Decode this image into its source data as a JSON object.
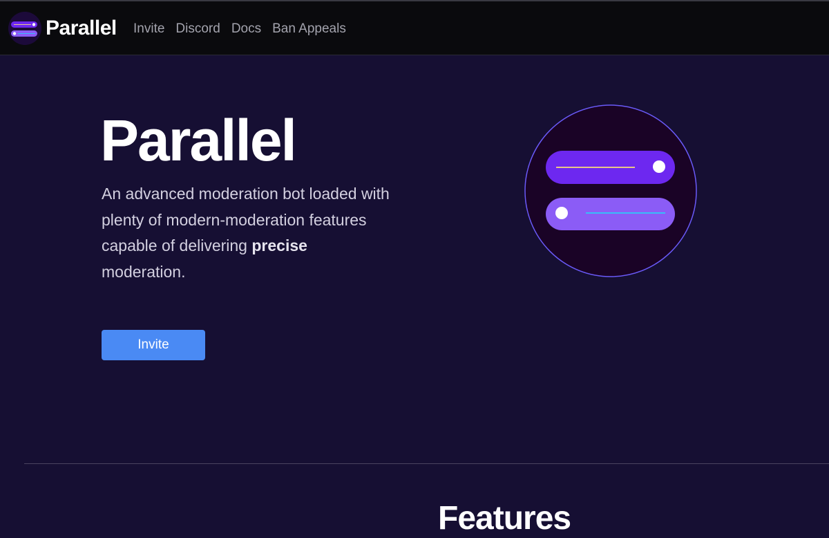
{
  "brand": {
    "name": "Parallel",
    "logo_icon": "parallel-toggles-logo"
  },
  "nav": {
    "items": [
      {
        "label": "Invite"
      },
      {
        "label": "Discord"
      },
      {
        "label": "Docs"
      },
      {
        "label": "Ban Appeals"
      }
    ]
  },
  "hero": {
    "title": "Parallel",
    "description_before": "An advanced moderation bot loaded with plenty of modern-moderation features capable of delivering ",
    "description_bold": "precise",
    "description_after": " moderation.",
    "invite_label": "Invite",
    "illustration_icon": "parallel-toggles-illustration"
  },
  "features": {
    "heading": "Features"
  },
  "colors": {
    "page_background": "#160f33",
    "topbar_background": "#0a0a0d",
    "accent_button": "#4a8af4",
    "toggle_dark": "#6d28f0",
    "toggle_light": "#8b5cf6",
    "circle_border": "#6a5af9",
    "line_yellow": "#e8c58a",
    "line_cyan": "#38bdf8"
  }
}
